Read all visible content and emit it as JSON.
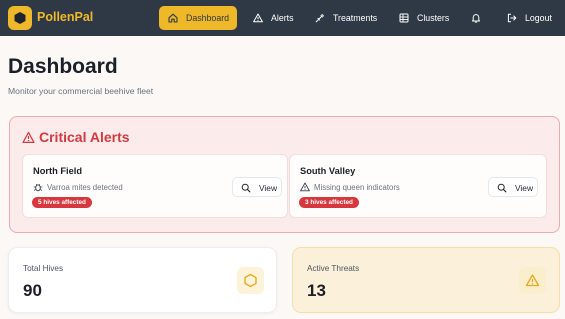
{
  "brand": {
    "name": "PollenPal",
    "logo_icon": "hexagon-icon",
    "accent": "#efb829"
  },
  "nav": {
    "items": [
      {
        "label": "Dashboard",
        "icon": "home-icon",
        "active": true
      },
      {
        "label": "Alerts",
        "icon": "warning-icon",
        "active": false
      },
      {
        "label": "Treatments",
        "icon": "syringe-icon",
        "active": false
      },
      {
        "label": "Clusters",
        "icon": "grid-icon",
        "active": false
      }
    ],
    "notifications_icon": "bell-icon",
    "logout": {
      "label": "Logout",
      "icon": "logout-icon"
    }
  },
  "header": {
    "title": "Dashboard",
    "subtitle": "Monitor your commercial beehive fleet"
  },
  "critical_alerts": {
    "title": "Critical Alerts",
    "icon": "warning-icon",
    "color": "#d13a42",
    "cards": [
      {
        "location": "North Field",
        "issue": "Varroa mites detected",
        "issue_icon": "bug-icon",
        "badge": "5 hives affected",
        "action": "View"
      },
      {
        "location": "South Valley",
        "issue": "Missing queen indicators",
        "issue_icon": "warning-icon",
        "badge": "3 hives affected",
        "action": "View"
      }
    ]
  },
  "stats": [
    {
      "label": "Total Hives",
      "value": "90",
      "icon": "hexagon-icon"
    },
    {
      "label": "Active Threats",
      "value": "13",
      "icon": "warning-icon"
    }
  ]
}
